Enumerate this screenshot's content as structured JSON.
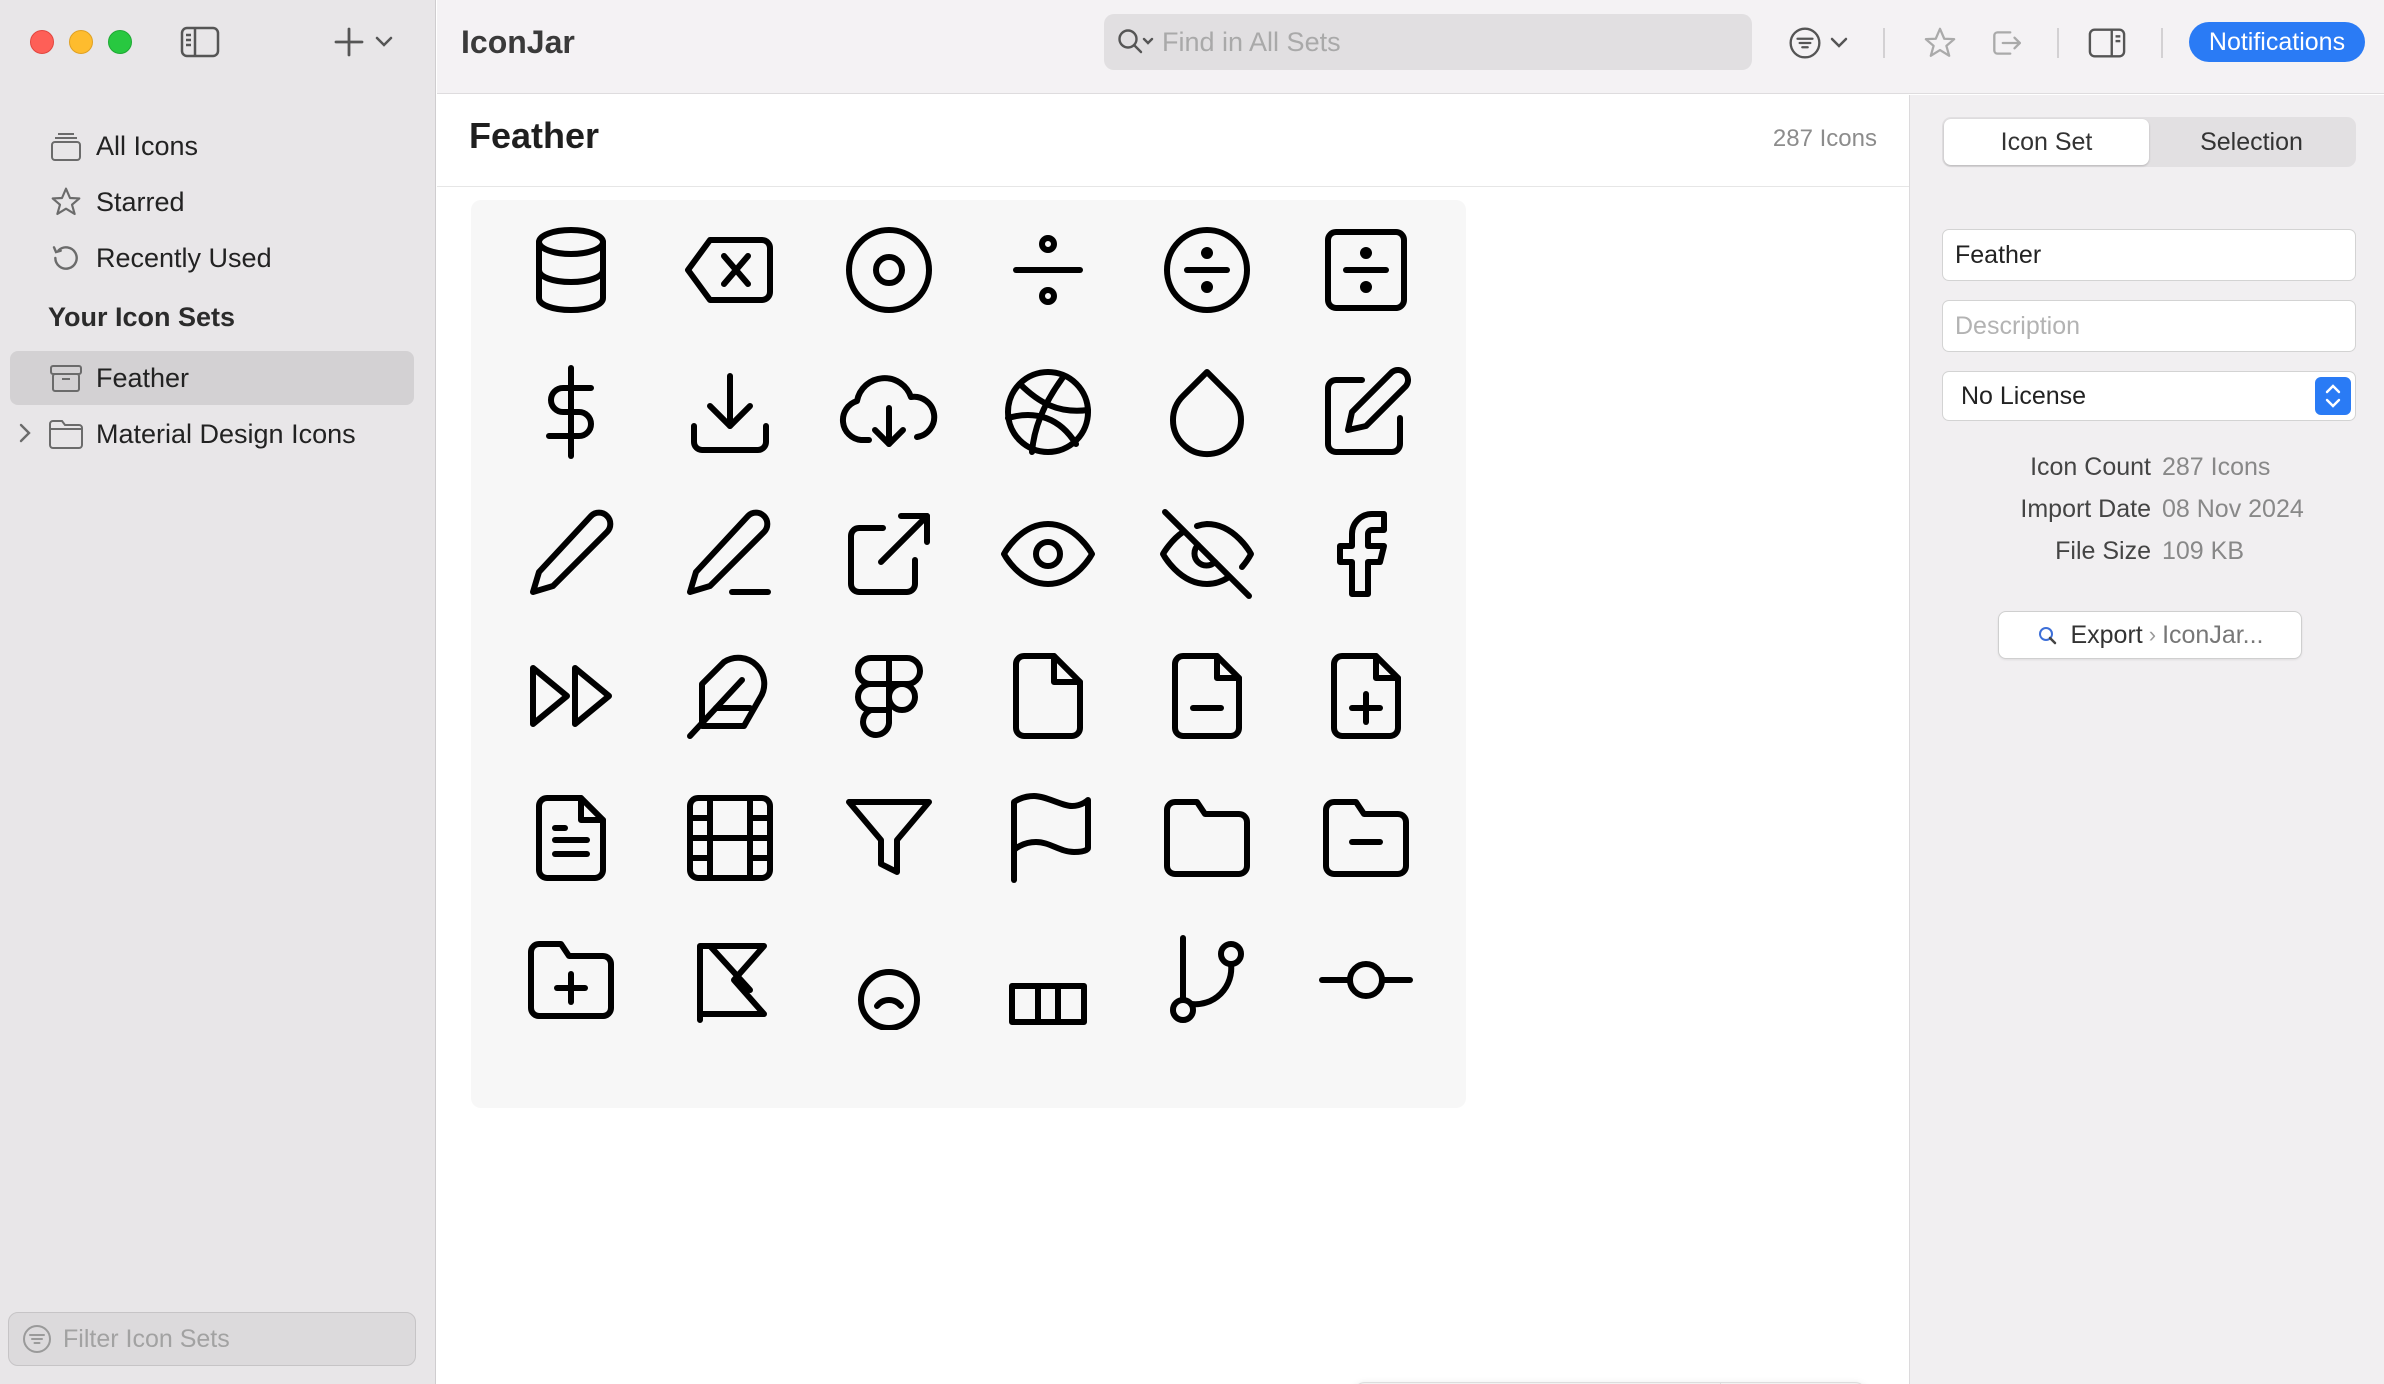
{
  "window": {
    "app_title": "IconJar"
  },
  "sidebar": {
    "items": [
      {
        "label": "All Icons",
        "icon": "stack-icon"
      },
      {
        "label": "Starred",
        "icon": "star-icon"
      },
      {
        "label": "Recently Used",
        "icon": "history-icon"
      }
    ],
    "section_title": "Your Icon Sets",
    "sets": [
      {
        "label": "Feather",
        "icon": "archive-box-icon",
        "selected": true
      },
      {
        "label": "Material Design Icons",
        "icon": "folder-icon",
        "selected": false
      }
    ],
    "filter_placeholder": "Filter Icon Sets"
  },
  "toolbar": {
    "search_placeholder": "Find in All Sets",
    "notifications_label": "Notifications"
  },
  "main": {
    "set_title": "Feather",
    "icon_count": "287 Icons",
    "icons": [
      "Database",
      "Delete",
      "Disc",
      "Divide",
      "Divide Circle",
      "Divide Square",
      "Dollar Sign",
      "Download",
      "Download Cloud",
      "Dribbble",
      "Droplet",
      "Edit",
      "Edit 2",
      "Edit 3",
      "External Link",
      "Eye",
      "Eye Off",
      "Facebook",
      "Fast Forward",
      "Feather",
      "Figma",
      "File",
      "File Minus",
      "File Plus",
      "File Text",
      "Film",
      "Filter",
      "Flag",
      "Folder",
      "Folder Minus",
      "",
      "",
      "",
      "",
      "",
      ""
    ],
    "icon_size": "60pt",
    "icon_size_fraction": 0.22
  },
  "inspector": {
    "tabs": [
      "Icon Set",
      "Selection"
    ],
    "active_tab": 0,
    "name_value": "Feather",
    "description_placeholder": "Description",
    "license_value": "No License",
    "meta": [
      {
        "key": "Icon Count",
        "value": "287 Icons"
      },
      {
        "key": "Import Date",
        "value": "08 Nov 2024"
      },
      {
        "key": "File Size",
        "value": "109 KB"
      }
    ],
    "export_label": "Export",
    "export_target": "IconJar..."
  },
  "colors": {
    "accent": "#2a7bf5",
    "sidebar_bg": "#e8e6e8",
    "selection_bg": "#d3d1d3"
  }
}
